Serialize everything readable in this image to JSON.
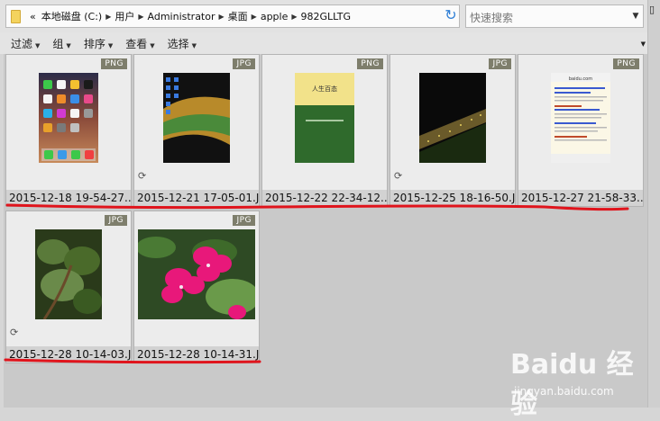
{
  "address": {
    "back_label": "«",
    "crumbs": [
      "本地磁盘 (C:)",
      "用户",
      "Administrator",
      "桌面",
      "apple",
      "982GLLTG"
    ],
    "sep": "▶"
  },
  "search": {
    "placeholder": "快速搜索"
  },
  "toolbar": {
    "filter": "过滤",
    "group": "组",
    "sort": "排序",
    "view": "查看",
    "select": "选择"
  },
  "files": [
    {
      "name": "2015-12-18 19-54-27...",
      "type": "PNG",
      "sync": false
    },
    {
      "name": "2015-12-21 17-05-01.J...",
      "type": "JPG",
      "sync": true
    },
    {
      "name": "2015-12-22 22-34-12...",
      "type": "PNG",
      "sync": false
    },
    {
      "name": "2015-12-25 18-16-50.J...",
      "type": "JPG",
      "sync": true
    },
    {
      "name": "2015-12-27 21-58-33...",
      "type": "PNG",
      "sync": false
    },
    {
      "name": "2015-12-28 10-14-03.J...",
      "type": "JPG",
      "sync": true
    },
    {
      "name": "2015-12-28 10-14-31.J...",
      "type": "JPG",
      "sync": false
    }
  ],
  "thumb_texts": {
    "book_title": "人生百态",
    "phone_site": "baidu.com"
  },
  "watermark": {
    "main": "Baidu 经验",
    "sub": "jingyan.baidu.com"
  },
  "colors": {
    "annotation": "#e0141c",
    "badge": "#7e7e6c",
    "refresh": "#2f7fd6"
  }
}
